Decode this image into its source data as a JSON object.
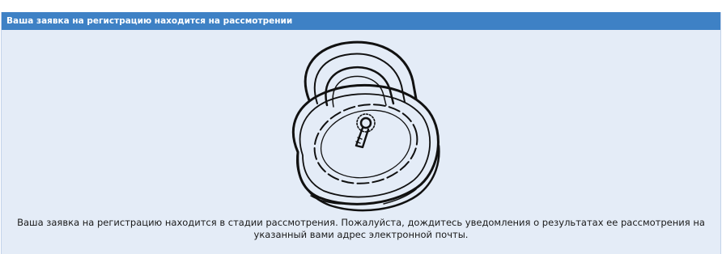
{
  "panel": {
    "title": "Ваша заявка на регистрацию находится на рассмотрении",
    "message": "Ваша заявка на регистрацию находится в стадии рассмотрения. Пожалуйста, дождитесь уведомления о результатах ее рассмотрения на указанный вами адрес электронной почты."
  },
  "illustration": {
    "icon": "padlock-icon"
  },
  "colors": {
    "header_background": "#3e81c5",
    "panel_background": "#e4ecf7",
    "header_text": "#ffffff",
    "body_text": "#1a1a1a"
  }
}
